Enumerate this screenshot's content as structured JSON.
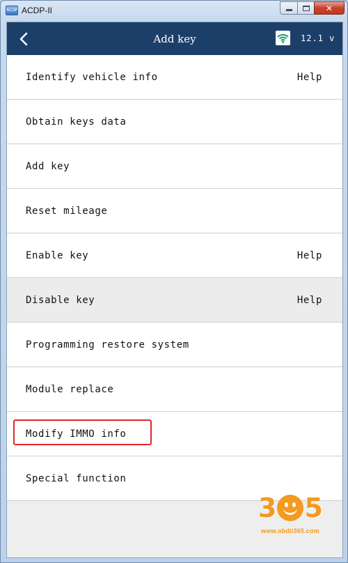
{
  "window": {
    "title": "ACDP-II",
    "app_icon_text": "ACDP",
    "minimize_label": "",
    "maximize_label": "",
    "close_label": "✕"
  },
  "header": {
    "title": "Add key",
    "voltage": "12.1 v",
    "back_icon": "chevron-left-icon",
    "wifi_icon": "wifi-icon",
    "background_color": "#1c3f6a"
  },
  "menu": {
    "items": [
      {
        "label": "Identify vehicle info",
        "help": "Help"
      },
      {
        "label": "Obtain keys data",
        "help": ""
      },
      {
        "label": "Add key",
        "help": ""
      },
      {
        "label": "Reset mileage",
        "help": ""
      },
      {
        "label": "Enable key",
        "help": "Help"
      },
      {
        "label": "Disable key",
        "help": "Help"
      },
      {
        "label": "Programming restore system",
        "help": ""
      },
      {
        "label": "Module replace",
        "help": ""
      },
      {
        "label": "Modify IMMO info",
        "help": ""
      },
      {
        "label": "Special function",
        "help": ""
      }
    ],
    "highlighted_item": "Modify IMMO info",
    "highlight_color": "#e0272b",
    "shaded_item": "Disable key"
  },
  "watermark": {
    "digit1": "3",
    "digit2": "5",
    "url": "www.obdii365.com",
    "color": "#f39a21"
  }
}
